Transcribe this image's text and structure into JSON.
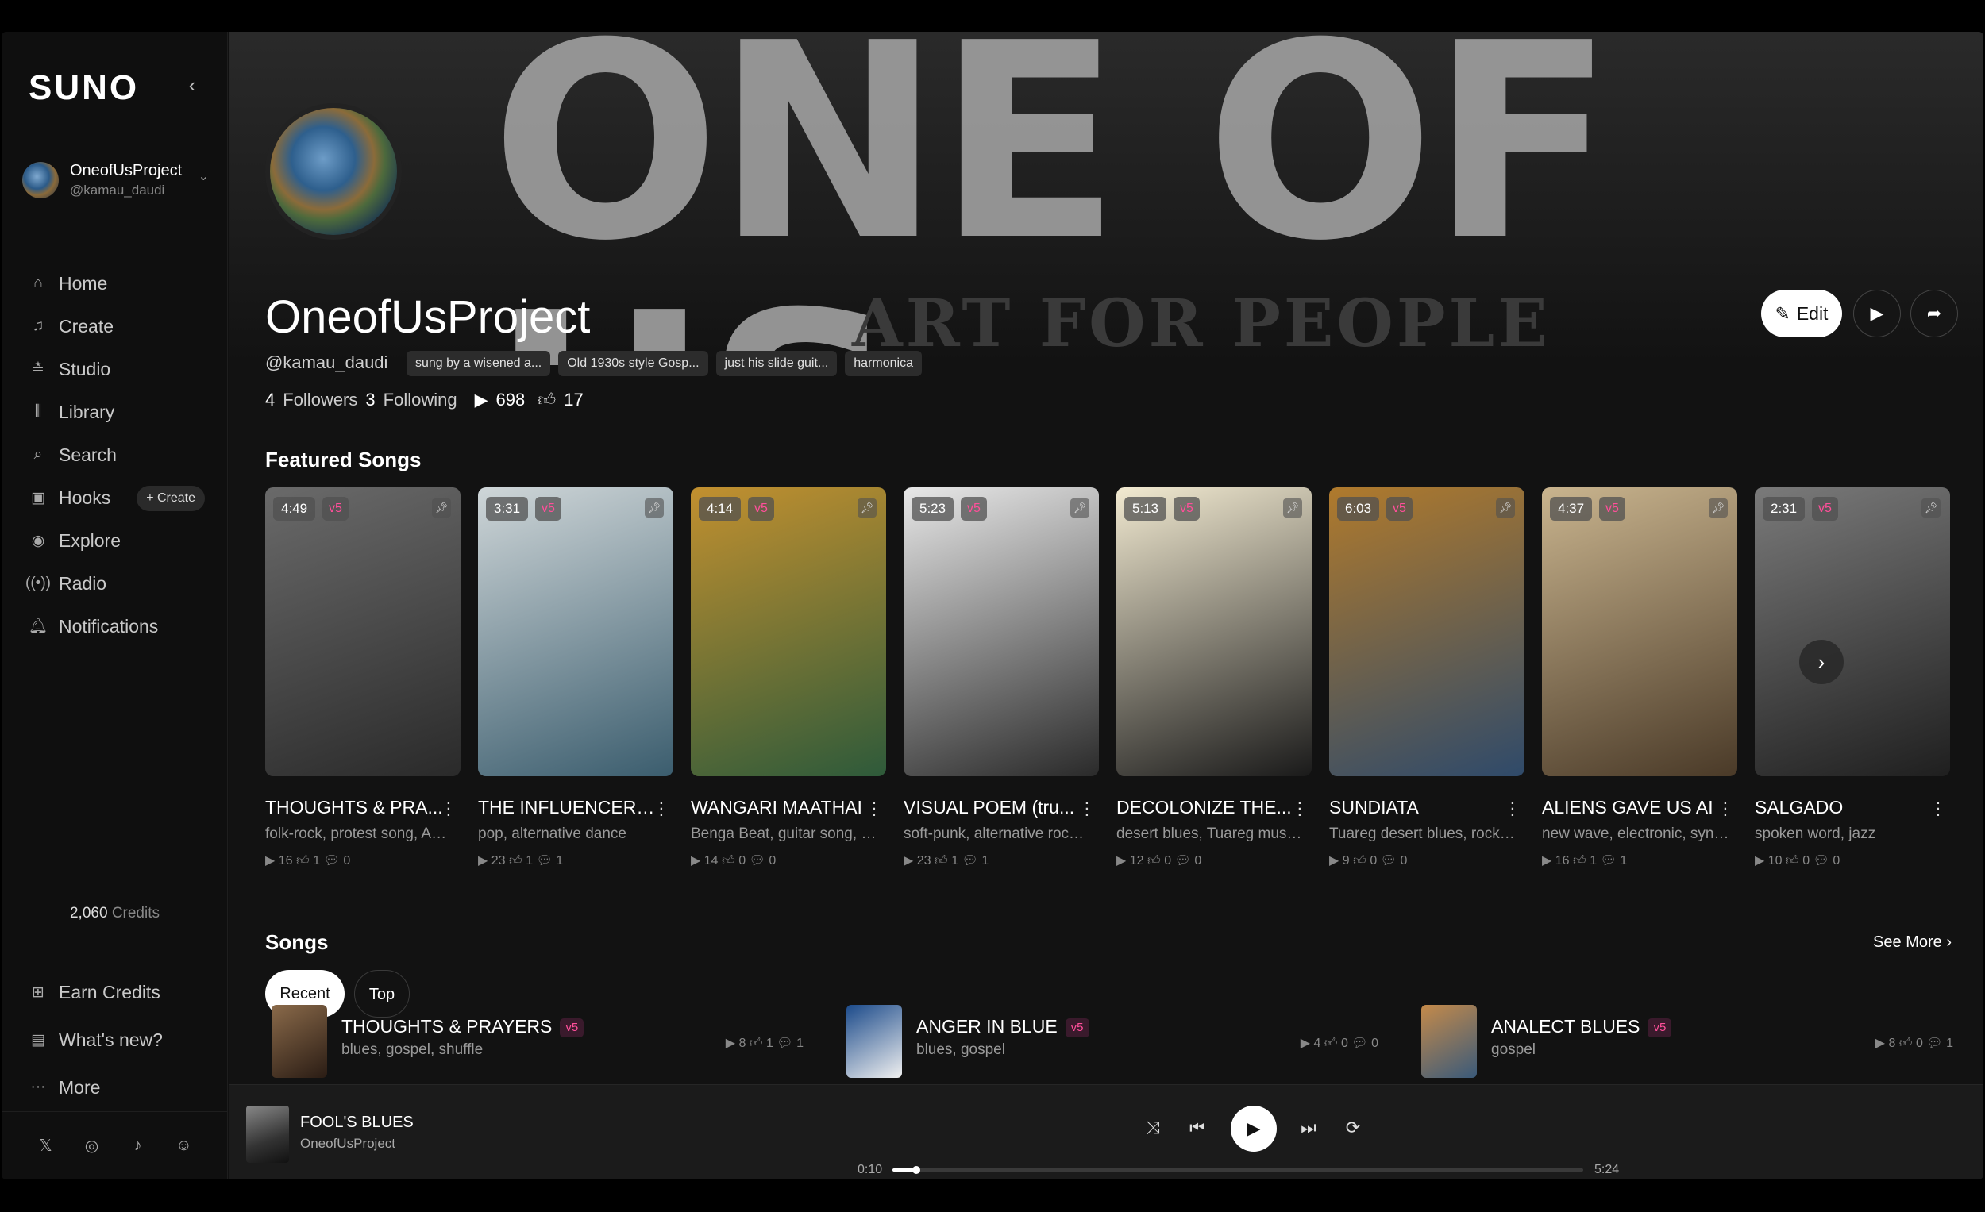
{
  "sidebar": {
    "logo": "SUNO",
    "profile": {
      "name": "OneofUsProject",
      "handle": "@kamau_daudi"
    },
    "nav": [
      {
        "label": "Home",
        "icon": "home-icon"
      },
      {
        "label": "Create",
        "icon": "music-note-icon"
      },
      {
        "label": "Studio",
        "icon": "sliders-icon"
      },
      {
        "label": "Library",
        "icon": "library-icon"
      },
      {
        "label": "Search",
        "icon": "search-icon"
      },
      {
        "label": "Hooks",
        "icon": "hook-icon",
        "badge": "+ Create"
      },
      {
        "label": "Explore",
        "icon": "compass-icon"
      },
      {
        "label": "Radio",
        "icon": "radio-icon"
      },
      {
        "label": "Notifications",
        "icon": "bell-icon"
      }
    ],
    "credits": {
      "value": "2,060",
      "label": "Credits"
    },
    "bottom": [
      {
        "label": "Earn Credits",
        "icon": "gift-icon"
      },
      {
        "label": "What's new?",
        "icon": "news-icon"
      },
      {
        "label": "More",
        "icon": "ellipsis-icon"
      }
    ],
    "social": [
      "x-icon",
      "instagram-icon",
      "tiktok-icon",
      "discord-icon"
    ]
  },
  "banner": {
    "big_text": "ONE OF US",
    "small_text": "ART FOR PEOPLE"
  },
  "profile": {
    "name": "OneofUsProject",
    "handle": "@kamau_daudi",
    "tags": [
      "sung by a wisened a...",
      "Old 1930s style Gosp...",
      "just his slide guit...",
      "harmonica"
    ],
    "followers": "4",
    "followers_label": "Followers",
    "following": "3",
    "following_label": "Following",
    "plays": "698",
    "likes": "17",
    "edit_label": "Edit"
  },
  "featured": {
    "title": "Featured Songs",
    "cards": [
      {
        "duration": "4:49",
        "version": "v5",
        "title": "THOUGHTS & PRA...",
        "genre": "folk-rock, protest song, Am...",
        "plays": "16",
        "likes": "1",
        "comments": "0",
        "colors": [
          "#6a6a6a",
          "#2a2a2a"
        ]
      },
      {
        "duration": "3:31",
        "version": "v5",
        "title": "THE INFLUENCER ...",
        "genre": "pop, alternative dance",
        "plays": "23",
        "likes": "1",
        "comments": "1",
        "colors": [
          "#cfd6d8",
          "#3b5d6e"
        ]
      },
      {
        "duration": "4:14",
        "version": "v5",
        "title": "WANGARI MAATHAI",
        "genre": "Benga Beat, guitar song, f... d",
        "plays": "14",
        "likes": "0",
        "comments": "0",
        "colors": [
          "#c2902f",
          "#2e5a3a"
        ]
      },
      {
        "duration": "5:23",
        "version": "v5",
        "title": "VISUAL POEM (tru...",
        "genre": "soft-punk, alternative rock, ...",
        "plays": "23",
        "likes": "1",
        "comments": "1",
        "colors": [
          "#e8e8e8",
          "#2a2a2a"
        ]
      },
      {
        "duration": "5:13",
        "version": "v5",
        "title": "DECOLONIZE THE...",
        "genre": "desert blues, Tuareg music,...",
        "plays": "12",
        "likes": "0",
        "comments": "0",
        "colors": [
          "#f2ead1",
          "#1a1a1a"
        ]
      },
      {
        "duration": "6:03",
        "version": "v5",
        "title": "SUNDIATA",
        "genre": "Tuareg desert blues, rock, t...",
        "plays": "9",
        "likes": "0",
        "comments": "0",
        "colors": [
          "#b07a2c",
          "#2f4a6a"
        ]
      },
      {
        "duration": "4:37",
        "version": "v5",
        "title": "ALIENS GAVE US AI",
        "genre": "new wave, electronic, synth...",
        "plays": "16",
        "likes": "1",
        "comments": "1",
        "colors": [
          "#c9b48e",
          "#4a3a28"
        ]
      },
      {
        "duration": "2:31",
        "version": "v5",
        "title": "SALGADO",
        "genre": "spoken word, jazz",
        "plays": "10",
        "likes": "0",
        "comments": "0",
        "colors": [
          "#7a7a7a",
          "#1f1f1f"
        ]
      }
    ]
  },
  "songs": {
    "title": "Songs",
    "see_more": "See More",
    "tabs": [
      "Recent",
      "Top"
    ],
    "items": [
      {
        "title": "THOUGHTS & PRAYERS",
        "version": "v5",
        "genre": "blues, gospel, shuffle",
        "plays": "8",
        "likes": "1",
        "comments": "1",
        "colors": [
          "#8a6a4a",
          "#2a1c14"
        ]
      },
      {
        "title": "ANGER IN BLUE",
        "version": "v5",
        "genre": "blues, gospel",
        "plays": "4",
        "likes": "0",
        "comments": "0",
        "colors": [
          "#1b4a8a",
          "#f0f0f0"
        ]
      },
      {
        "title": "ANALECT BLUES",
        "version": "v5",
        "genre": "gospel",
        "plays": "8",
        "likes": "0",
        "comments": "1",
        "colors": [
          "#c48a4a",
          "#3a5a7a"
        ]
      }
    ]
  },
  "player": {
    "title": "FOOL'S BLUES",
    "artist": "OneofUsProject",
    "elapsed": "0:10",
    "total": "5:24",
    "progress": 0.031
  }
}
